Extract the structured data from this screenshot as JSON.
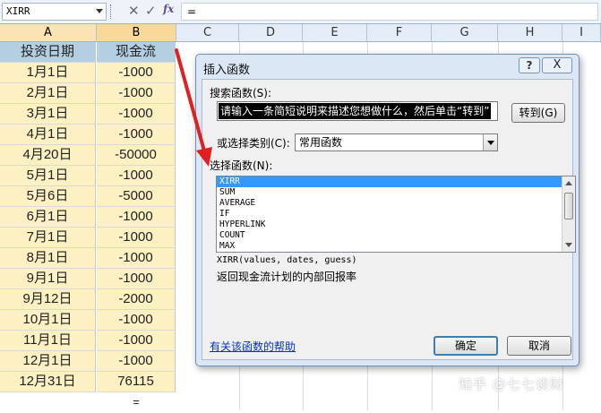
{
  "formula_bar": {
    "name_box": "XIRR",
    "cancel_glyph": "✕",
    "enter_glyph": "✓",
    "fx_label": "fx",
    "formula": "="
  },
  "columns": [
    "A",
    "B",
    "C",
    "D",
    "E",
    "F",
    "G",
    "H",
    "I"
  ],
  "table": {
    "headers": [
      "投资日期",
      "现金流"
    ],
    "rows": [
      [
        "1月1日",
        "-1000"
      ],
      [
        "2月1日",
        "-1000"
      ],
      [
        "3月1日",
        "-1000"
      ],
      [
        "4月1日",
        "-1000"
      ],
      [
        "4月20日",
        "-50000"
      ],
      [
        "5月1日",
        "-1000"
      ],
      [
        "5月6日",
        "-5000"
      ],
      [
        "6月1日",
        "-1000"
      ],
      [
        "7月1日",
        "-1000"
      ],
      [
        "8月1日",
        "-1000"
      ],
      [
        "9月1日",
        "-1000"
      ],
      [
        "9月12日",
        "-2000"
      ],
      [
        "10月1日",
        "-1000"
      ],
      [
        "11月1日",
        "-1000"
      ],
      [
        "12月1日",
        "-1000"
      ],
      [
        "12月31日",
        "76115"
      ]
    ],
    "formula_cell": "="
  },
  "dialog": {
    "title": "插入函数",
    "help_glyph": "?",
    "close_glyph": "X",
    "search_label": "搜索函数(S):",
    "search_value": "请输入一条简短说明来描述您想做什么，然后单击“转到”",
    "go_button": "转到(G)",
    "category_label": "或选择类别(C):",
    "category_value": "常用函数",
    "function_label": "选择函数(N):",
    "functions": [
      "XIRR",
      "SUM",
      "AVERAGE",
      "IF",
      "HYPERLINK",
      "COUNT",
      "MAX"
    ],
    "selected_function": "XIRR",
    "signature": "XIRR(values, dates, guess)",
    "description": "返回现金流计划的内部回报率",
    "help_link": "有关该函数的帮助",
    "ok_button": "确定",
    "cancel_button": "取消"
  },
  "watermark": "知乎 @七七谈财",
  "colors": {
    "header_fill": "#b4cfe2",
    "data_fill": "#fdf1c3",
    "selected_col_header": "#f9d99a",
    "list_selection": "#3399ff",
    "arrow": "#e02020"
  }
}
